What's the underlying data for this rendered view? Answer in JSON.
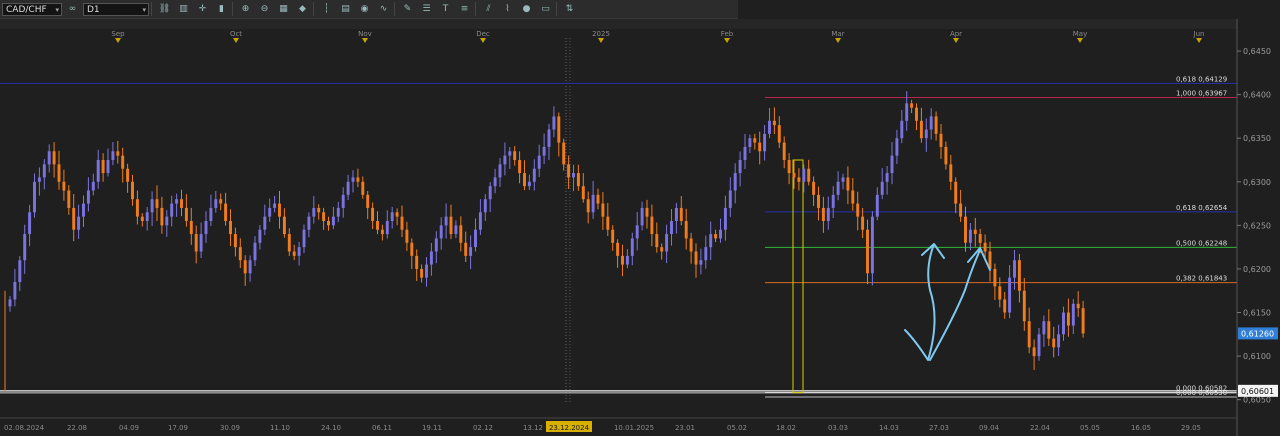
{
  "toolbar": {
    "symbol": "CAD/CHF",
    "timeframe": "D1",
    "icons": [
      "link-icon",
      "bar-chart-icon",
      "crosshair-icon",
      "candle-icon",
      "zoom-in-icon",
      "zoom-out-icon",
      "grid-icon",
      "marker-icon",
      "period-separator-icon",
      "template-icon",
      "color-picker-icon",
      "indicator-icon",
      "pencil-icon",
      "object-list-icon",
      "text-tool-icon",
      "fibonacci-icon",
      "channel-icon",
      "brush-icon",
      "shape-icon",
      "eraser-icon",
      "arrow-icon"
    ]
  },
  "colors": {
    "background": "#1f1f1f",
    "bull_candle": "#7b74e0",
    "bear_candle": "#f07c1e",
    "fib_blue": "#2631a8",
    "fib_red": "#b8254f",
    "fib_green": "#31b53a",
    "fib_orange": "#d96a24",
    "hand_drawn": "#7ec8f0",
    "current_price_tag": "#2f7fd6"
  },
  "chart_data": {
    "type": "candlestick",
    "symbol": "CAD/CHF",
    "timeframe": "D1",
    "ylim": [
      0.6045,
      0.6465
    ],
    "y_ticks": [
      "0,6450",
      "0,6400",
      "0,6350",
      "0,6300",
      "0,6250",
      "0,6200",
      "0,6150",
      "0,6100",
      "0,6050"
    ],
    "month_labels": [
      "Sep",
      "Oct",
      "Nov",
      "Dec",
      "2025",
      "Feb",
      "Mar",
      "Apr",
      "May",
      "Jun"
    ],
    "date_labels": [
      "02.08.2024",
      "22.08",
      "04.09",
      "17.09",
      "30.09",
      "11.10",
      "24.10",
      "06.11",
      "19.11",
      "02.12",
      "13.12",
      "23.12.2024",
      "10.01.2025",
      "23.01",
      "05.02",
      "18.02",
      "03.03",
      "14.03",
      "27.03",
      "09.04",
      "22.04",
      "05.05",
      "16.05",
      "29.05"
    ],
    "current_price": "0,61260",
    "horizontal_line_price": "0,60601",
    "fib_labels": [
      {
        "level": "0,618",
        "price": "0,64129"
      },
      {
        "level": "1,000",
        "price": "0,63967"
      },
      {
        "level": "0,618",
        "price": "0,62654"
      },
      {
        "level": "0,500",
        "price": "0,62248"
      },
      {
        "level": "0,382",
        "price": "0,61843"
      },
      {
        "level": "0,000",
        "price": "0,60582"
      },
      {
        "level": "0,000",
        "price": "0,60530"
      }
    ],
    "fib_values": [
      0.64129,
      0.63967,
      0.62654,
      0.62248,
      0.61843,
      0.60582,
      0.6053
    ],
    "close": [
      0.6165,
      0.6185,
      0.621,
      0.624,
      0.6265,
      0.63,
      0.6305,
      0.632,
      0.6335,
      0.632,
      0.63,
      0.629,
      0.627,
      0.6245,
      0.626,
      0.6275,
      0.629,
      0.63,
      0.6325,
      0.631,
      0.6325,
      0.6335,
      0.633,
      0.6315,
      0.63,
      0.628,
      0.626,
      0.6255,
      0.6265,
      0.628,
      0.627,
      0.625,
      0.626,
      0.6275,
      0.628,
      0.627,
      0.6255,
      0.624,
      0.622,
      0.624,
      0.6255,
      0.627,
      0.628,
      0.6275,
      0.6255,
      0.624,
      0.6225,
      0.621,
      0.6195,
      0.621,
      0.623,
      0.6245,
      0.626,
      0.627,
      0.6275,
      0.626,
      0.624,
      0.622,
      0.6215,
      0.6225,
      0.6245,
      0.626,
      0.627,
      0.6265,
      0.6255,
      0.625,
      0.626,
      0.627,
      0.6285,
      0.63,
      0.6305,
      0.63,
      0.6285,
      0.627,
      0.6255,
      0.6245,
      0.624,
      0.6255,
      0.6265,
      0.626,
      0.6245,
      0.623,
      0.6215,
      0.62,
      0.619,
      0.6205,
      0.622,
      0.6235,
      0.625,
      0.626,
      0.624,
      0.625,
      0.623,
      0.6215,
      0.6225,
      0.6245,
      0.6265,
      0.628,
      0.6295,
      0.6305,
      0.632,
      0.633,
      0.6335,
      0.6325,
      0.631,
      0.6295,
      0.63,
      0.6315,
      0.633,
      0.634,
      0.636,
      0.6375,
      0.6345,
      0.632,
      0.6305,
      0.631,
      0.6295,
      0.628,
      0.6265,
      0.6285,
      0.6275,
      0.626,
      0.6245,
      0.623,
      0.6215,
      0.6205,
      0.6215,
      0.6235,
      0.625,
      0.627,
      0.626,
      0.624,
      0.6225,
      0.622,
      0.624,
      0.6255,
      0.627,
      0.6255,
      0.6235,
      0.622,
      0.6205,
      0.621,
      0.6225,
      0.624,
      0.6235,
      0.6245,
      0.627,
      0.629,
      0.631,
      0.6325,
      0.634,
      0.635,
      0.6345,
      0.6335,
      0.6355,
      0.637,
      0.6365,
      0.6345,
      0.6325,
      0.631,
      0.6305,
      0.63,
      0.6315,
      0.63,
      0.6285,
      0.627,
      0.6255,
      0.627,
      0.6285,
      0.63,
      0.6305,
      0.629,
      0.6275,
      0.626,
      0.6245,
      0.6195,
      0.626,
      0.6285,
      0.63,
      0.631,
      0.633,
      0.635,
      0.637,
      0.639,
      0.6385,
      0.637,
      0.635,
      0.636,
      0.6375,
      0.6355,
      0.634,
      0.632,
      0.63,
      0.6275,
      0.626,
      0.623,
      0.6245,
      0.624,
      0.623,
      0.622,
      0.62,
      0.618,
      0.6165,
      0.615,
      0.619,
      0.621,
      0.6175,
      0.614,
      0.611,
      0.61,
      0.6125,
      0.614,
      0.612,
      0.611,
      0.6125,
      0.615,
      0.6135,
      0.616,
      0.6155,
      0.6126
    ]
  }
}
